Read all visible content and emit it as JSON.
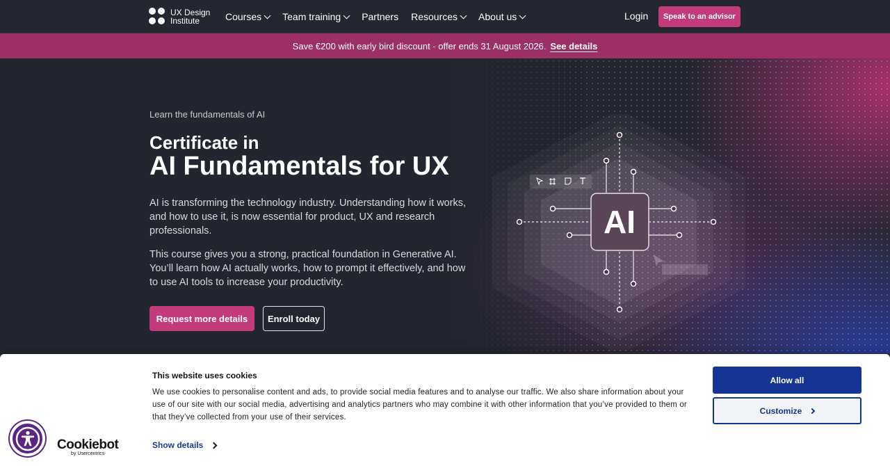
{
  "nav": {
    "logo_line1": "UX Design",
    "logo_line2": "Institute",
    "links": [
      {
        "label": "Courses",
        "has_dropdown": true
      },
      {
        "label": "Team training",
        "has_dropdown": true
      },
      {
        "label": "Partners",
        "has_dropdown": false
      },
      {
        "label": "Resources",
        "has_dropdown": true
      },
      {
        "label": "About us",
        "has_dropdown": true
      }
    ],
    "login": "Login",
    "cta": "Speak to an advisor"
  },
  "promo": {
    "text": "Save €200 with early bird discount - offer ends 31 August 2026.",
    "link": "See details"
  },
  "hero": {
    "kicker": "Learn the fundamentals of AI",
    "title_line1": "Certificate in",
    "title_line2": "AI Fundamentals for UX",
    "paragraph1": "AI is transforming the technology industry. Understanding how it works, and how to use it, is now essential for product, UX and research professionals.",
    "paragraph2": "This course gives you a strong, practical foundation in Generative AI. You’ll learn how AI actually works, how to prompt it effectively, and how to use AI tools to increase your productivity.",
    "primary_button": "Request more details",
    "secondary_button": "Enroll today",
    "chip_label": "AI"
  },
  "cookie": {
    "title": "This website uses cookies",
    "body": "We use cookies to personalise content and ads, to provide social media features and to analyse our traffic. We also share information about your use of our site with our social media, advertising and analytics partners who may combine it with other information that you’ve provided to them or that they’ve collected from your use of their services.",
    "show_details": "Show details",
    "allow_all": "Allow all",
    "customize": "Customize",
    "brand": "Cookiebot",
    "brand_sub": "by Usercentrics"
  },
  "colors": {
    "brand_pink": "#c43b7b",
    "promo_bg": "#9c2f66",
    "cookie_blue": "#143596",
    "accessibility_purple": "#5a2681"
  }
}
